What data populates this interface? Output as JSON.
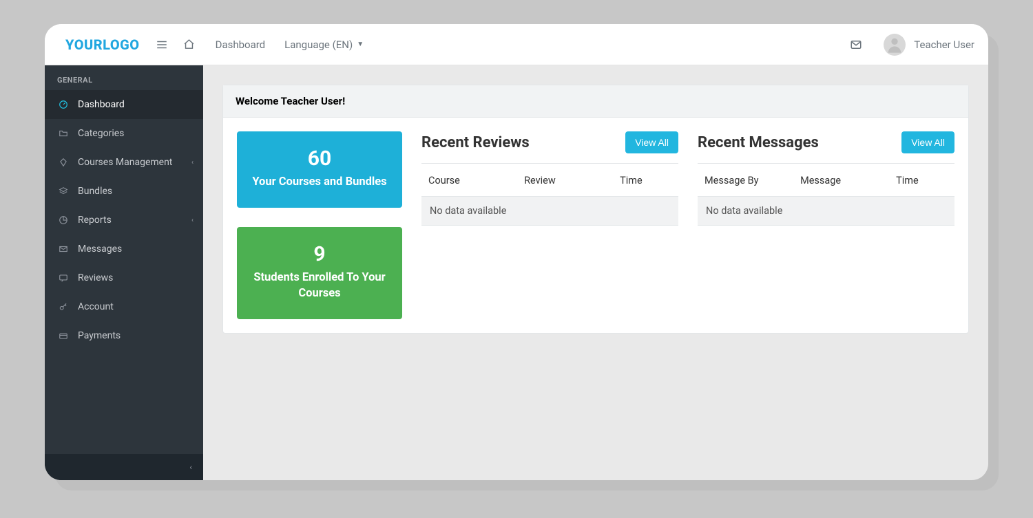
{
  "header": {
    "logo": "YOURLOGO",
    "nav": {
      "dashboard": "Dashboard",
      "language": "Language (EN)"
    },
    "user": "Teacher User"
  },
  "sidebar": {
    "heading": "GENERAL",
    "items": [
      {
        "label": "Dashboard"
      },
      {
        "label": "Categories"
      },
      {
        "label": "Courses Management"
      },
      {
        "label": "Bundles"
      },
      {
        "label": "Reports"
      },
      {
        "label": "Messages"
      },
      {
        "label": "Reviews"
      },
      {
        "label": "Account"
      },
      {
        "label": "Payments"
      }
    ]
  },
  "main": {
    "welcome": "Welcome Teacher User!",
    "stats": [
      {
        "value": "60",
        "label": "Your Courses and Bundles"
      },
      {
        "value": "9",
        "label": "Students Enrolled To Your Courses"
      }
    ],
    "reviews": {
      "title": "Recent Reviews",
      "view_all": "View All",
      "cols": [
        "Course",
        "Review",
        "Time"
      ],
      "empty": "No data available"
    },
    "messages": {
      "title": "Recent Messages",
      "view_all": "View All",
      "cols": [
        "Message By",
        "Message",
        "Time"
      ],
      "empty": "No data available"
    }
  }
}
